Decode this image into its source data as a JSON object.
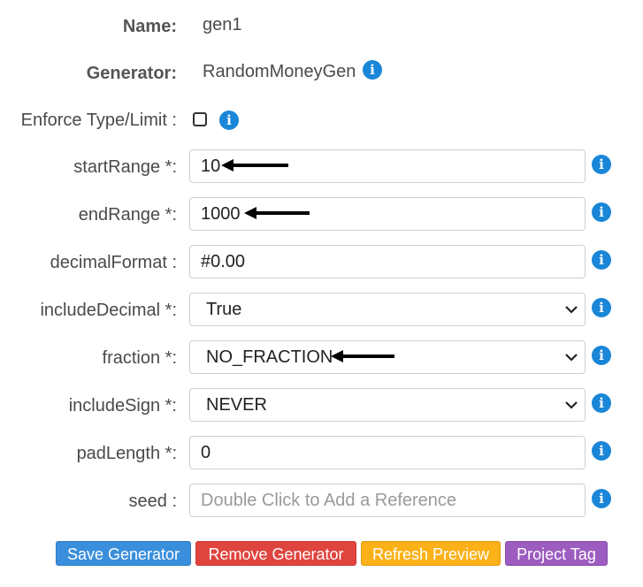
{
  "form": {
    "name": {
      "label": "Name:",
      "value": "gen1"
    },
    "generator": {
      "label": "Generator:",
      "value": "RandomMoneyGen"
    },
    "enforce": {
      "label": "Enforce Type/Limit :",
      "checked": false
    },
    "startRange": {
      "label": "startRange *:",
      "value": "10"
    },
    "endRange": {
      "label": "endRange *:",
      "value": "1000"
    },
    "decimalFormat": {
      "label": "decimalFormat :",
      "value": "#0.00"
    },
    "includeDecimal": {
      "label": "includeDecimal *:",
      "value": "True"
    },
    "fraction": {
      "label": "fraction *:",
      "value": "NO_FRACTION"
    },
    "includeSign": {
      "label": "includeSign *:",
      "value": "NEVER"
    },
    "padLength": {
      "label": "padLength *:",
      "value": "0"
    },
    "seed": {
      "label": "seed :",
      "value": "",
      "placeholder": "Double Click to Add a Reference"
    }
  },
  "info_icon_glyph": "i",
  "buttons": {
    "save": "Save Generator",
    "remove": "Remove Generator",
    "refresh": "Refresh Preview",
    "project_tag": "Project Tag"
  },
  "colors": {
    "save": "#3a8fdc",
    "remove": "#e0443e",
    "refresh": "#fbb117",
    "project_tag": "#9d5cc0",
    "info": "#1a86d8"
  },
  "icons": [
    "info-icon",
    "chevron-down-icon",
    "arrow-left-icon",
    "checkbox"
  ]
}
